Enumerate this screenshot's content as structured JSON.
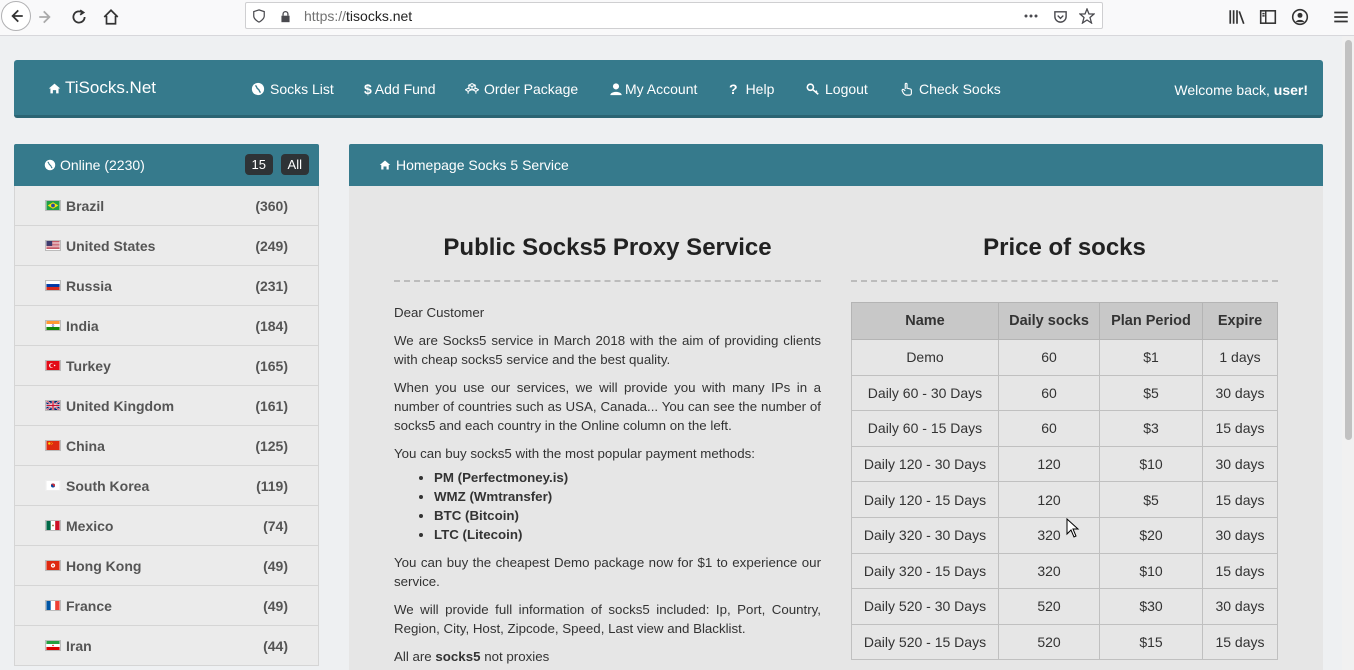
{
  "browser": {
    "url_scheme": "https://",
    "url_host": "tisocks.net"
  },
  "navbar": {
    "brand": "TiSocks.Net",
    "items": [
      {
        "label": "Socks List",
        "icon": "globe-icon"
      },
      {
        "label": "Add Fund",
        "icon": "dollar-icon"
      },
      {
        "label": "Order Package",
        "icon": "cubes-icon"
      },
      {
        "label": "My Account",
        "icon": "user-icon"
      },
      {
        "label": "Help",
        "icon": "question-icon"
      },
      {
        "label": "Logout",
        "icon": "key-icon"
      },
      {
        "label": "Check Socks",
        "icon": "hand-pointer-icon"
      }
    ],
    "welcome_prefix": "Welcome back, ",
    "welcome_user": "user!"
  },
  "sidebar": {
    "title": "Online (2230)",
    "badge_count": "15",
    "badge_all": "All",
    "countries": [
      {
        "name": "Brazil",
        "count": "(360)",
        "flag": "brazil"
      },
      {
        "name": "United States",
        "count": "(249)",
        "flag": "usa"
      },
      {
        "name": "Russia",
        "count": "(231)",
        "flag": "russia"
      },
      {
        "name": "India",
        "count": "(184)",
        "flag": "india"
      },
      {
        "name": "Turkey",
        "count": "(165)",
        "flag": "turkey"
      },
      {
        "name": "United Kingdom",
        "count": "(161)",
        "flag": "uk"
      },
      {
        "name": "China",
        "count": "(125)",
        "flag": "china"
      },
      {
        "name": "South Korea",
        "count": "(119)",
        "flag": "south-korea"
      },
      {
        "name": "Mexico",
        "count": "(74)",
        "flag": "mexico"
      },
      {
        "name": "Hong Kong",
        "count": "(49)",
        "flag": "hong-kong"
      },
      {
        "name": "France",
        "count": "(49)",
        "flag": "france"
      },
      {
        "name": "Iran",
        "count": "(44)",
        "flag": "iran"
      }
    ]
  },
  "main": {
    "header": "Homepage Socks 5 Service",
    "left_title": "Public Socks5 Proxy Service",
    "greeting": "Dear Customer",
    "para1": "We are Socks5 service in March 2018 with the aim of providing clients with cheap socks5 service and the best quality.",
    "para2": "When you use our services, we will provide you with many IPs in a number of countries such as USA, Canada... You can see the number of socks5 and each country in the Online column on the left.",
    "para3": "You can buy socks5 with the most popular payment methods:",
    "payments": [
      "PM (Perfectmoney.is)",
      "WMZ (Wmtransfer)",
      "BTC (Bitcoin)",
      "LTC (Litecoin)"
    ],
    "para4": "You can buy the cheapest Demo package now for $1 to experience our service.",
    "para5": "We will provide full information of socks5 included: Ip, Port, Country, Region, City, Host, Zipcode, Speed, Last view and Blacklist.",
    "para6_prefix": "All are ",
    "para6_bold": "socks5",
    "para6_suffix": " not proxies",
    "right_title": "Price of socks",
    "table_headers": [
      "Name",
      "Daily socks",
      "Plan Period",
      "Expire"
    ],
    "table_rows": [
      [
        "Demo",
        "60",
        "$1",
        "1 days"
      ],
      [
        "Daily 60 - 30 Days",
        "60",
        "$5",
        "30 days"
      ],
      [
        "Daily 60 - 15 Days",
        "60",
        "$3",
        "15 days"
      ],
      [
        "Daily 120 - 30 Days",
        "120",
        "$10",
        "30 days"
      ],
      [
        "Daily 120 - 15 Days",
        "120",
        "$5",
        "15 days"
      ],
      [
        "Daily 320 - 30 Days",
        "320",
        "$20",
        "30 days"
      ],
      [
        "Daily 320 - 15 Days",
        "320",
        "$10",
        "15 days"
      ],
      [
        "Daily 520 - 30 Days",
        "520",
        "$30",
        "30 days"
      ],
      [
        "Daily 520 - 15 Days",
        "520",
        "$15",
        "15 days"
      ]
    ]
  },
  "colors": {
    "brand_teal": "#367a8c",
    "panel_bg": "#e6e6e6",
    "badge_dark": "#2e3336"
  }
}
